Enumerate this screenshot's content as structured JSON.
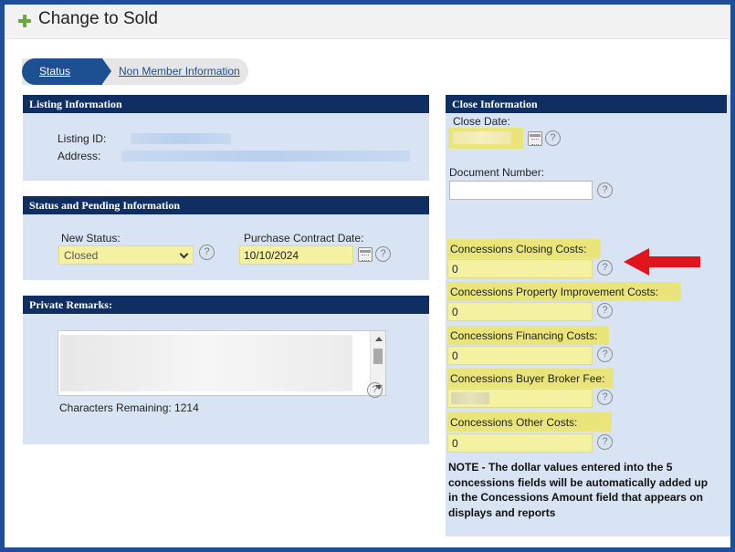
{
  "header": {
    "title": "Change to Sold",
    "plus_icon": "plus-icon"
  },
  "tabs": [
    {
      "label": "Status",
      "active": true
    },
    {
      "label": "Non Member Information",
      "active": false
    }
  ],
  "listing_information": {
    "heading": "Listing Information",
    "listing_id_label": "Listing ID:",
    "address_label": "Address:"
  },
  "status_pending": {
    "heading": "Status and Pending Information",
    "new_status_label": "New Status:",
    "new_status_value": "Closed",
    "purchase_contract_label": "Purchase Contract Date:",
    "purchase_contract_value": "10/10/2024"
  },
  "private_remarks": {
    "heading": "Private Remarks:",
    "characters_remaining": "Characters Remaining: 1214"
  },
  "close_information": {
    "heading": "Close Information",
    "close_date_label": "Close Date:",
    "document_number_label": "Document Number:",
    "closing_costs_label": "Concessions Closing Costs:",
    "closing_costs_value": "0",
    "property_improvement_label": "Concessions Property Improvement Costs:",
    "property_improvement_value": "0",
    "financing_label": "Concessions Financing Costs:",
    "financing_value": "0",
    "buyer_broker_label": "Concessions Buyer Broker Fee:",
    "other_costs_label": "Concessions Other Costs:",
    "other_costs_value": "0",
    "note": "NOTE - The dollar values entered into the 5 concessions fields will be automatically added up in the Concessions Amount field that appears on displays and reports"
  },
  "help_glyph": "?",
  "colors": {
    "header_navy": "#0f2f62",
    "tab_blue": "#1d4f93",
    "panel_bg": "#d8e4f3",
    "highlight": "#e9e57b",
    "arrow_red": "#e0141c",
    "frame_blue": "#1f4e96"
  }
}
